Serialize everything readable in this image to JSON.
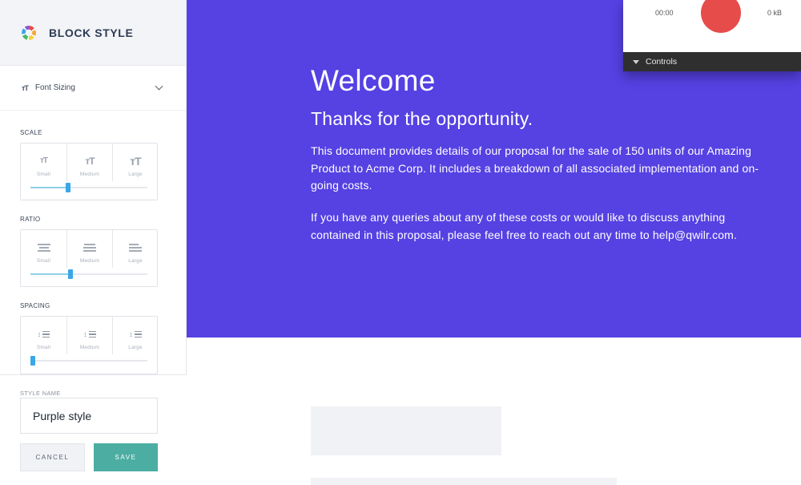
{
  "sidebar": {
    "title": "BLOCK STYLE",
    "logo": "qwilr-logo",
    "dropdown": {
      "icon": "ᴛT",
      "label": "Font Sizing"
    },
    "scale": {
      "label": "SCALE",
      "options": [
        {
          "label": "Small",
          "icon": "font-size-small-icon"
        },
        {
          "label": "Medium",
          "icon": "font-size-medium-icon"
        },
        {
          "label": "Large",
          "icon": "font-size-large-icon"
        }
      ],
      "value": 0.32
    },
    "ratio": {
      "label": "RATIO",
      "options": [
        {
          "label": "Small",
          "icon": "align-small-icon"
        },
        {
          "label": "Medium",
          "icon": "align-medium-icon"
        },
        {
          "label": "Large",
          "icon": "align-large-icon"
        }
      ],
      "value": 0.34
    },
    "spacing": {
      "label": "SPACING",
      "options": [
        {
          "label": "Small",
          "icon": "line-spacing-small-icon"
        },
        {
          "label": "Medium",
          "icon": "line-spacing-medium-icon"
        },
        {
          "label": "Large",
          "icon": "line-spacing-large-icon"
        }
      ],
      "value": 0.0
    },
    "style_name": {
      "label": "STYLE NAME",
      "value": "Purple style"
    },
    "cancel_label": "CANCEL",
    "save_label": "SAVE"
  },
  "hero": {
    "title": "Welcome",
    "subtitle": "Thanks for the opportunity.",
    "paragraph1": "This document provides details of our proposal for the sale of 150 units of our Amazing Product to Acme Corp. It includes a breakdown of all associated implementation and on-going costs.",
    "paragraph2": "If you have any queries about any of these costs or would like to discuss anything contained in this proposal, please feel free to reach out any time to help@qwilr.com."
  },
  "recorder": {
    "time": "00:00",
    "size": "0 kB",
    "controls_label": "Controls"
  },
  "colors": {
    "hero_bg": "#5641e3",
    "save_button": "#4cada2",
    "record_button": "#e64c4a",
    "slider_handle": "#3aa7e8"
  }
}
